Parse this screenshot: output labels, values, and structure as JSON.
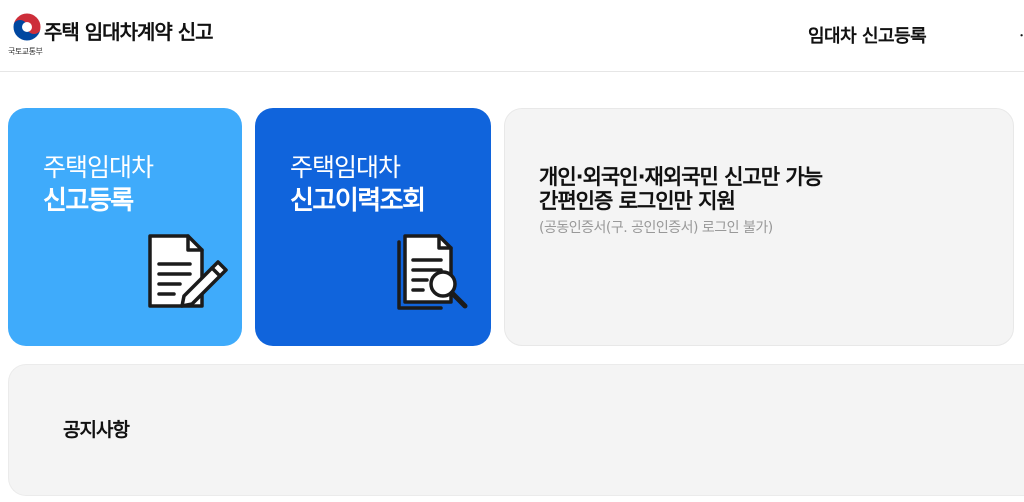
{
  "header": {
    "site_title": "주택 임대차계약 신고",
    "ministry": "국토교통부",
    "nav": [
      "임대차 신고등록"
    ],
    "nav_edge": "ᆢ"
  },
  "cards": {
    "register": {
      "line1": "주택임대차",
      "line2": "신고등록",
      "icon": "document-pen-icon"
    },
    "history": {
      "line1": "주택임대차",
      "line2": "신고이력조회",
      "icon": "document-search-icon"
    }
  },
  "info": {
    "line1": "개인·외국인·재외국민 신고만 가능",
    "line2": "간편인증 로그인만 지원",
    "note": "(공동인증서(구. 공인인증서) 로그인 불가)"
  },
  "notice": {
    "title": "공지사항"
  },
  "colors": {
    "register_card": "#3fabfb",
    "history_card": "#1064dc",
    "info_card": "#f4f4f4",
    "emblem_red": "#cd2e3a",
    "emblem_blue": "#0047a0"
  }
}
